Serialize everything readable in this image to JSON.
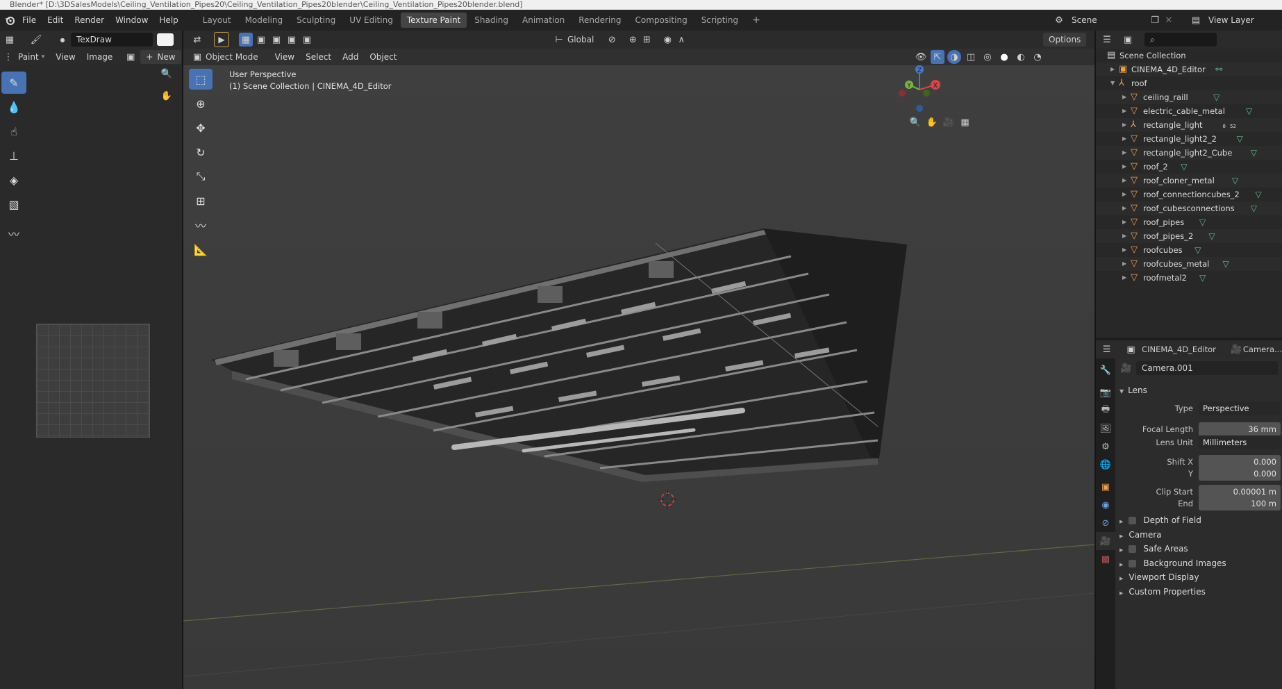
{
  "title_bar": "Blender* [D:\\3DSalesModels\\Ceiling_Ventilation_Pipes20\\Ceiling_Ventilation_Pipes20blender\\Ceiling_Ventilation_Pipes20blender.blend]",
  "menu": [
    "File",
    "Edit",
    "Render",
    "Window",
    "Help"
  ],
  "workspaces": [
    "Layout",
    "Modeling",
    "Sculpting",
    "UV Editing",
    "Texture Paint",
    "Shading",
    "Animation",
    "Rendering",
    "Compositing",
    "Scripting"
  ],
  "active_workspace": "Texture Paint",
  "scene": {
    "name": "Scene",
    "view_layer": "View Layer"
  },
  "left_panel": {
    "brush_name": "TexDraw",
    "menus": [
      "Paint",
      "View",
      "Image"
    ],
    "new_label": "New"
  },
  "viewport": {
    "mode": "Object Mode",
    "menus": [
      "View",
      "Select",
      "Add",
      "Object"
    ],
    "orientation": "Global",
    "options_label": "Options",
    "overlay_line1": "User Perspective",
    "overlay_line2": "(1) Scene Collection | CINEMA_4D_Editor",
    "gizmo_labels": {
      "x": "X",
      "y": "Y",
      "z": "Z"
    }
  },
  "outliner": {
    "items": [
      {
        "label": "Scene Collection",
        "icon": "collection-icon",
        "depth": 0
      },
      {
        "label": "CINEMA_4D_Editor",
        "icon": "camera-object-icon",
        "depth": 1
      },
      {
        "label": "roof",
        "icon": "empty-icon",
        "depth": 1
      },
      {
        "label": "ceiling_raill",
        "icon": "mesh-object-icon",
        "depth": 2
      },
      {
        "label": "electric_cable_metal",
        "icon": "mesh-object-icon",
        "depth": 2
      },
      {
        "label": "rectangle_light",
        "icon": "empty-icon",
        "depth": 2,
        "badges": [
          "8",
          "52"
        ]
      },
      {
        "label": "rectangle_light2_2",
        "icon": "mesh-object-icon",
        "depth": 2
      },
      {
        "label": "rectangle_light2_Cube",
        "icon": "mesh-object-icon",
        "depth": 2
      },
      {
        "label": "roof_2",
        "icon": "mesh-object-icon",
        "depth": 2
      },
      {
        "label": "roof_cloner_metal",
        "icon": "mesh-object-icon",
        "depth": 2
      },
      {
        "label": "roof_connectioncubes_2",
        "icon": "mesh-object-icon",
        "depth": 2
      },
      {
        "label": "roof_cubesconnections",
        "icon": "mesh-object-icon",
        "depth": 2
      },
      {
        "label": "roof_pipes",
        "icon": "mesh-object-icon",
        "depth": 2
      },
      {
        "label": "roof_pipes_2",
        "icon": "mesh-object-icon",
        "depth": 2
      },
      {
        "label": "roofcubes",
        "icon": "mesh-object-icon",
        "depth": 2
      },
      {
        "label": "roofcubes_metal",
        "icon": "mesh-object-icon",
        "depth": 2
      },
      {
        "label": "roofmetal2",
        "icon": "mesh-object-icon",
        "depth": 2
      }
    ]
  },
  "properties": {
    "breadcrumb_object": "CINEMA_4D_Editor",
    "breadcrumb_data": "Camera...",
    "datablock_name": "Camera.001",
    "lens": {
      "heading": "Lens",
      "type_label": "Type",
      "type_value": "Perspective",
      "focal_label": "Focal Length",
      "focal_value": "36 mm",
      "unit_label": "Lens Unit",
      "unit_value": "Millimeters",
      "shiftx_label": "Shift X",
      "shiftx_value": "0.000",
      "shifty_label": "Y",
      "shifty_value": "0.000",
      "clipstart_label": "Clip Start",
      "clipstart_value": "0.00001 m",
      "clipend_label": "End",
      "clipend_value": "100 m"
    },
    "panels": [
      {
        "label": "Depth of Field",
        "checkbox": true
      },
      {
        "label": "Camera",
        "checkbox": false
      },
      {
        "label": "Safe Areas",
        "checkbox": true
      },
      {
        "label": "Background Images",
        "checkbox": true
      },
      {
        "label": "Viewport Display",
        "checkbox": false
      },
      {
        "label": "Custom Properties",
        "checkbox": false
      }
    ]
  },
  "colors": {
    "accent": "#4772b3",
    "object_orange": "#f0a04a",
    "mesh_green": "#60c08a"
  }
}
